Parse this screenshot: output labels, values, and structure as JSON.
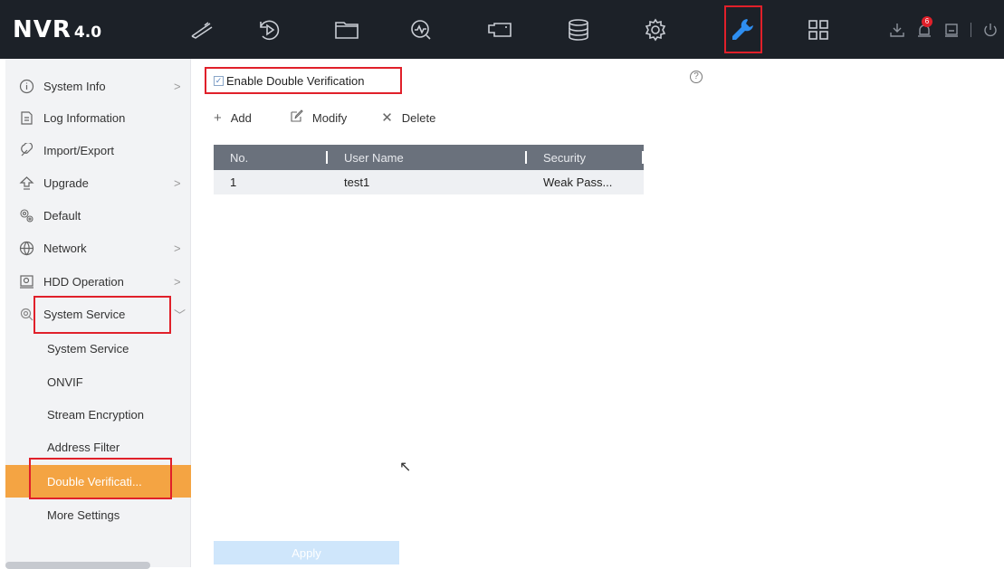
{
  "app": {
    "brand": "NVR",
    "version": "4.0"
  },
  "topnav": {
    "icons": [
      "live-view-icon",
      "playback-icon",
      "file-icon",
      "smart-analysis-icon",
      "camera-icon",
      "storage-icon",
      "configuration-icon",
      "maintenance-icon",
      "multi-view-icon"
    ],
    "active": "maintenance-icon",
    "alarm_count": "6"
  },
  "sidebar": {
    "items": [
      {
        "label": "System Info",
        "icon": "info-icon",
        "chevron": ">"
      },
      {
        "label": "Log Information",
        "icon": "log-icon",
        "chevron": ""
      },
      {
        "label": "Import/Export",
        "icon": "import-export-icon",
        "chevron": ""
      },
      {
        "label": "Upgrade",
        "icon": "upgrade-icon",
        "chevron": ">"
      },
      {
        "label": "Default",
        "icon": "default-icon",
        "chevron": ""
      },
      {
        "label": "Network",
        "icon": "network-icon",
        "chevron": ">"
      },
      {
        "label": "HDD Operation",
        "icon": "hdd-icon",
        "chevron": ">"
      },
      {
        "label": "System Service",
        "icon": "system-service-icon",
        "chevron": "﹀"
      }
    ],
    "subitems": [
      {
        "label": "System Service"
      },
      {
        "label": "ONVIF"
      },
      {
        "label": "Stream Encryption"
      },
      {
        "label": "Address Filter"
      },
      {
        "label": "Double Verificati..."
      },
      {
        "label": "More Settings"
      }
    ],
    "active_subitem": "Double Verificati..."
  },
  "content": {
    "enable_label": "Enable Double Verification",
    "enable_checked": true,
    "help_symbol": "?",
    "toolbar": {
      "add_label": "Add",
      "modify_label": "Modify",
      "delete_label": "Delete"
    },
    "table": {
      "headers": [
        "No.",
        "User Name",
        "Security"
      ],
      "rows": [
        {
          "no": "1",
          "user": "test1",
          "security": "Weak Pass..."
        }
      ]
    },
    "apply_label": "Apply"
  },
  "colors": {
    "topbar": "#1c2128",
    "active_icon": "#2e8ef0",
    "highlight": "#f4a443",
    "annotation": "#e0202a",
    "table_header": "#6a717c",
    "apply_button": "#cfe6fb"
  }
}
